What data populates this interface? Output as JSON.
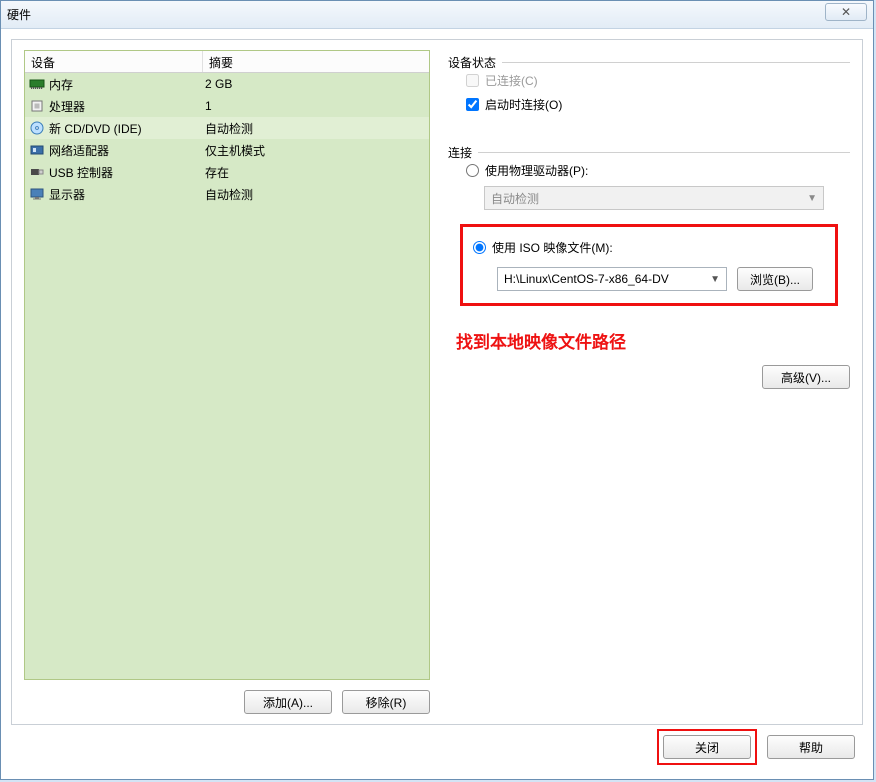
{
  "titlebar": {
    "title": "硬件",
    "close_glyph": "✕"
  },
  "table": {
    "head_device": "设备",
    "head_summary": "摘要",
    "rows": [
      {
        "icon": "memory",
        "name": "内存",
        "summary": "2 GB",
        "selected": false
      },
      {
        "icon": "cpu",
        "name": "处理器",
        "summary": "1",
        "selected": false
      },
      {
        "icon": "cd",
        "name": "新 CD/DVD (IDE)",
        "summary": "自动检测",
        "selected": true
      },
      {
        "icon": "nic",
        "name": "网络适配器",
        "summary": "仅主机模式",
        "selected": false
      },
      {
        "icon": "usb",
        "name": "USB 控制器",
        "summary": "存在",
        "selected": false
      },
      {
        "icon": "display",
        "name": "显示器",
        "summary": "自动检测",
        "selected": false
      }
    ]
  },
  "left_buttons": {
    "add": "添加(A)...",
    "remove": "移除(R)"
  },
  "status": {
    "legend": "设备状态",
    "connected_label": "已连接(C)",
    "connected_checked": false,
    "connected_disabled": true,
    "connect_poweron_label": "启动时连接(O)",
    "connect_poweron_checked": true
  },
  "connection": {
    "legend": "连接",
    "physical_label": "使用物理驱动器(P):",
    "physical_selected": false,
    "physical_dropdown": "自动检测",
    "iso_label": "使用 ISO 映像文件(M):",
    "iso_selected": true,
    "iso_path": "H:\\Linux\\CentOS-7-x86_64-DV",
    "browse_label": "浏览(B)..."
  },
  "annotation_text": "找到本地映像文件路径",
  "advanced_label": "高级(V)...",
  "footer": {
    "close": "关闭",
    "help": "帮助"
  }
}
